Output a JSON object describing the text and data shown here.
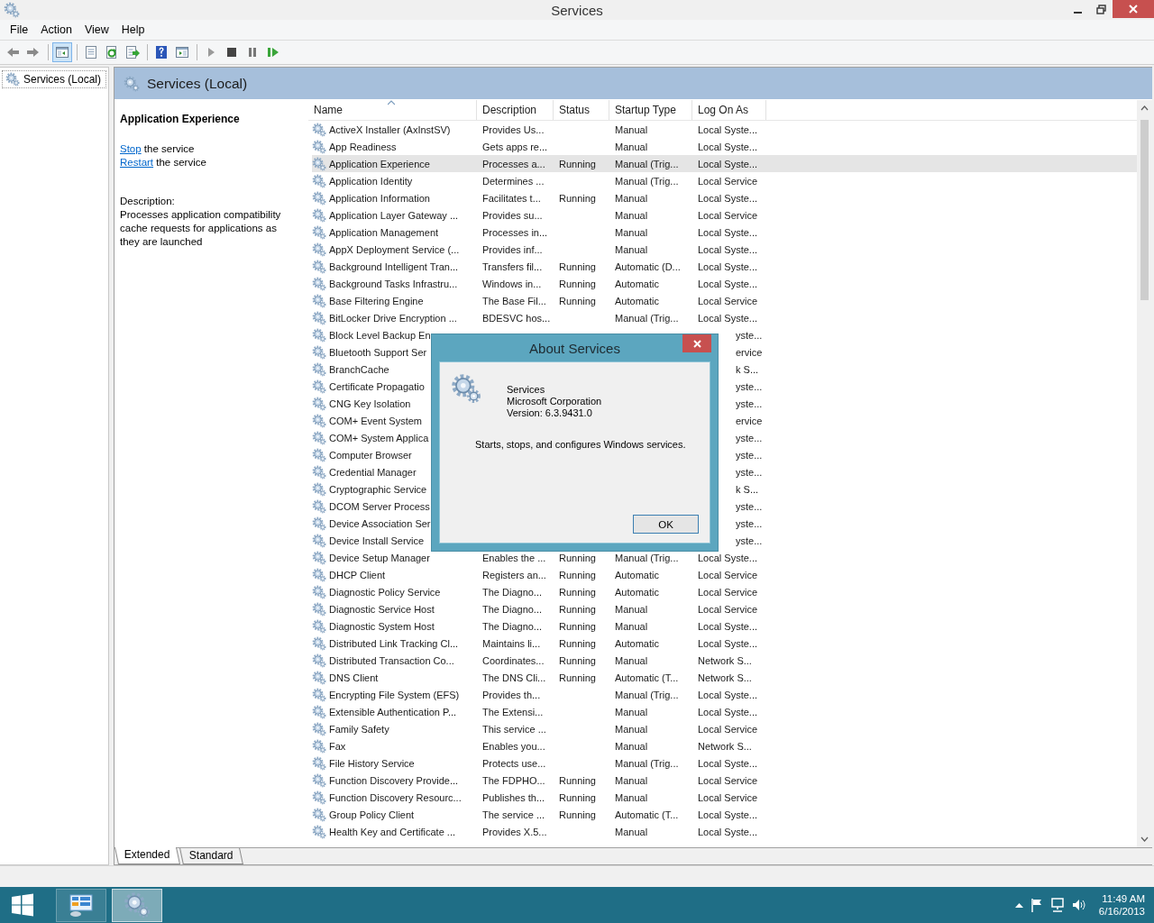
{
  "window": {
    "title": "Services"
  },
  "menu": [
    "File",
    "Action",
    "View",
    "Help"
  ],
  "toolbar": [
    {
      "kind": "back",
      "pressed": false
    },
    {
      "kind": "forward",
      "pressed": false
    },
    {
      "kind": "sep"
    },
    {
      "kind": "tree",
      "pressed": true
    },
    {
      "kind": "sep"
    },
    {
      "kind": "properties",
      "pressed": false
    },
    {
      "kind": "refresh",
      "pressed": false
    },
    {
      "kind": "export",
      "pressed": false
    },
    {
      "kind": "sep"
    },
    {
      "kind": "help",
      "pressed": false
    },
    {
      "kind": "actionpane",
      "pressed": false
    },
    {
      "kind": "sep"
    },
    {
      "kind": "play",
      "pressed": false
    },
    {
      "kind": "stop",
      "pressed": false
    },
    {
      "kind": "pause",
      "pressed": false
    },
    {
      "kind": "resume",
      "pressed": false
    }
  ],
  "tree": [
    {
      "label": "Services (Local)"
    }
  ],
  "header": {
    "title": "Services (Local)"
  },
  "details": {
    "service_name": "Application Experience",
    "actions": [
      {
        "link": "Stop",
        "text": " the service"
      },
      {
        "link": "Restart",
        "text": " the service"
      }
    ],
    "description_label": "Description:",
    "description": "Processes application compatibility cache requests for applications as they are launched"
  },
  "table": {
    "columns": [
      {
        "label": "Name",
        "sorted": true
      },
      {
        "label": "Description",
        "sorted": false
      },
      {
        "label": "Status",
        "sorted": false
      },
      {
        "label": "Startup Type",
        "sorted": false
      },
      {
        "label": "Log On As",
        "sorted": false
      }
    ],
    "rows": [
      {
        "name": "ActiveX Installer (AxInstSV)",
        "description": "Provides Us...",
        "startup_type": "Manual",
        "log_on_as": "Local Syste...",
        "selected": false,
        "covered": false
      },
      {
        "name": "App Readiness",
        "description": "Gets apps re...",
        "startup_type": "Manual",
        "log_on_as": "Local Syste...",
        "selected": false,
        "covered": false
      },
      {
        "name": "Application Experience",
        "description": "Processes a...",
        "status": "Running",
        "startup_type": "Manual (Trig...",
        "log_on_as": "Local Syste...",
        "selected": true,
        "covered": false
      },
      {
        "name": "Application Identity",
        "description": "Determines ...",
        "startup_type": "Manual (Trig...",
        "log_on_as": "Local Service",
        "selected": false,
        "covered": false
      },
      {
        "name": "Application Information",
        "description": "Facilitates t...",
        "status": "Running",
        "startup_type": "Manual",
        "log_on_as": "Local Syste...",
        "selected": false,
        "covered": false
      },
      {
        "name": "Application Layer Gateway ...",
        "description": "Provides su...",
        "startup_type": "Manual",
        "log_on_as": "Local Service",
        "selected": false,
        "covered": false
      },
      {
        "name": "Application Management",
        "description": "Processes in...",
        "startup_type": "Manual",
        "log_on_as": "Local Syste...",
        "selected": false,
        "covered": false
      },
      {
        "name": "AppX Deployment Service (...",
        "description": "Provides inf...",
        "startup_type": "Manual",
        "log_on_as": "Local Syste...",
        "selected": false,
        "covered": false
      },
      {
        "name": "Background Intelligent Tran...",
        "description": "Transfers fil...",
        "status": "Running",
        "startup_type": "Automatic (D...",
        "log_on_as": "Local Syste...",
        "selected": false,
        "covered": false
      },
      {
        "name": "Background Tasks Infrastru...",
        "description": "Windows in...",
        "status": "Running",
        "startup_type": "Automatic",
        "log_on_as": "Local Syste...",
        "selected": false,
        "covered": false
      },
      {
        "name": "Base Filtering Engine",
        "description": "The Base Fil...",
        "status": "Running",
        "startup_type": "Automatic",
        "log_on_as": "Local Service",
        "selected": false,
        "covered": false
      },
      {
        "name": "BitLocker Drive Encryption ...",
        "description": "BDESVC hos...",
        "startup_type": "Manual (Trig...",
        "log_on_as": "Local Syste...",
        "selected": false,
        "covered": false
      },
      {
        "name": "Block Level Backup En",
        "log_on_as": "yste...",
        "selected": false,
        "covered": true
      },
      {
        "name": "Bluetooth Support Ser",
        "log_on_as": "ervice",
        "selected": false,
        "covered": true
      },
      {
        "name": "BranchCache",
        "log_on_as": "k S...",
        "selected": false,
        "covered": true
      },
      {
        "name": "Certificate Propagatio",
        "log_on_as": "yste...",
        "selected": false,
        "covered": true
      },
      {
        "name": "CNG Key Isolation",
        "log_on_as": "yste...",
        "selected": false,
        "covered": true
      },
      {
        "name": "COM+ Event System",
        "log_on_as": "ervice",
        "selected": false,
        "covered": true
      },
      {
        "name": "COM+ System Applica",
        "log_on_as": "yste...",
        "selected": false,
        "covered": true
      },
      {
        "name": "Computer Browser",
        "log_on_as": "yste...",
        "selected": false,
        "covered": true
      },
      {
        "name": "Credential Manager",
        "log_on_as": "yste...",
        "selected": false,
        "covered": true
      },
      {
        "name": "Cryptographic Service",
        "log_on_as": "k S...",
        "selected": false,
        "covered": true
      },
      {
        "name": "DCOM Server Process",
        "log_on_as": "yste...",
        "selected": false,
        "covered": true
      },
      {
        "name": "Device Association Ser",
        "log_on_as": "yste...",
        "selected": false,
        "covered": true
      },
      {
        "name": "Device Install Service",
        "log_on_as": "yste...",
        "selected": false,
        "covered": true
      },
      {
        "name": "Device Setup Manager",
        "description": "Enables the ...",
        "status": "Running",
        "startup_type": "Manual (Trig...",
        "log_on_as": "Local Syste...",
        "selected": false,
        "covered": false
      },
      {
        "name": "DHCP Client",
        "description": "Registers an...",
        "status": "Running",
        "startup_type": "Automatic",
        "log_on_as": "Local Service",
        "selected": false,
        "covered": false
      },
      {
        "name": "Diagnostic Policy Service",
        "description": "The Diagno...",
        "status": "Running",
        "startup_type": "Automatic",
        "log_on_as": "Local Service",
        "selected": false,
        "covered": false
      },
      {
        "name": "Diagnostic Service Host",
        "description": "The Diagno...",
        "status": "Running",
        "startup_type": "Manual",
        "log_on_as": "Local Service",
        "selected": false,
        "covered": false
      },
      {
        "name": "Diagnostic System Host",
        "description": "The Diagno...",
        "status": "Running",
        "startup_type": "Manual",
        "log_on_as": "Local Syste...",
        "selected": false,
        "covered": false
      },
      {
        "name": "Distributed Link Tracking Cl...",
        "description": "Maintains li...",
        "status": "Running",
        "startup_type": "Automatic",
        "log_on_as": "Local Syste...",
        "selected": false,
        "covered": false
      },
      {
        "name": "Distributed Transaction Co...",
        "description": "Coordinates...",
        "status": "Running",
        "startup_type": "Manual",
        "log_on_as": "Network S...",
        "selected": false,
        "covered": false
      },
      {
        "name": "DNS Client",
        "description": "The DNS Cli...",
        "status": "Running",
        "startup_type": "Automatic (T...",
        "log_on_as": "Network S...",
        "selected": false,
        "covered": false
      },
      {
        "name": "Encrypting File System (EFS)",
        "description": "Provides th...",
        "startup_type": "Manual (Trig...",
        "log_on_as": "Local Syste...",
        "selected": false,
        "covered": false
      },
      {
        "name": "Extensible Authentication P...",
        "description": "The Extensi...",
        "startup_type": "Manual",
        "log_on_as": "Local Syste...",
        "selected": false,
        "covered": false
      },
      {
        "name": "Family Safety",
        "description": "This service ...",
        "startup_type": "Manual",
        "log_on_as": "Local Service",
        "selected": false,
        "covered": false
      },
      {
        "name": "Fax",
        "description": "Enables you...",
        "startup_type": "Manual",
        "log_on_as": "Network S...",
        "selected": false,
        "covered": false
      },
      {
        "name": "File History Service",
        "description": "Protects use...",
        "startup_type": "Manual (Trig...",
        "log_on_as": "Local Syste...",
        "selected": false,
        "covered": false
      },
      {
        "name": "Function Discovery Provide...",
        "description": "The FDPHO...",
        "status": "Running",
        "startup_type": "Manual",
        "log_on_as": "Local Service",
        "selected": false,
        "covered": false
      },
      {
        "name": "Function Discovery Resourc...",
        "description": "Publishes th...",
        "status": "Running",
        "startup_type": "Manual",
        "log_on_as": "Local Service",
        "selected": false,
        "covered": false
      },
      {
        "name": "Group Policy Client",
        "description": "The service ...",
        "status": "Running",
        "startup_type": "Automatic (T...",
        "log_on_as": "Local Syste...",
        "selected": false,
        "covered": false
      },
      {
        "name": "Health Key and Certificate ...",
        "description": "Provides X.5...",
        "startup_type": "Manual",
        "log_on_as": "Local Syste...",
        "selected": false,
        "covered": false
      }
    ]
  },
  "view_tabs": [
    {
      "label": "Extended",
      "selected": true
    },
    {
      "label": "Standard",
      "selected": false
    }
  ],
  "dialog": {
    "title": "About Services",
    "product": "Services",
    "company": "Microsoft Corporation",
    "version": "Version: 6.3.9431.0",
    "text": "Starts, stops, and configures Windows services.",
    "button": "OK"
  },
  "taskbar": {
    "apps": [
      {
        "kind": "control-panel",
        "active": false
      },
      {
        "kind": "services",
        "active": true
      }
    ],
    "time": "11:49 AM",
    "date": "6/16/2013"
  }
}
